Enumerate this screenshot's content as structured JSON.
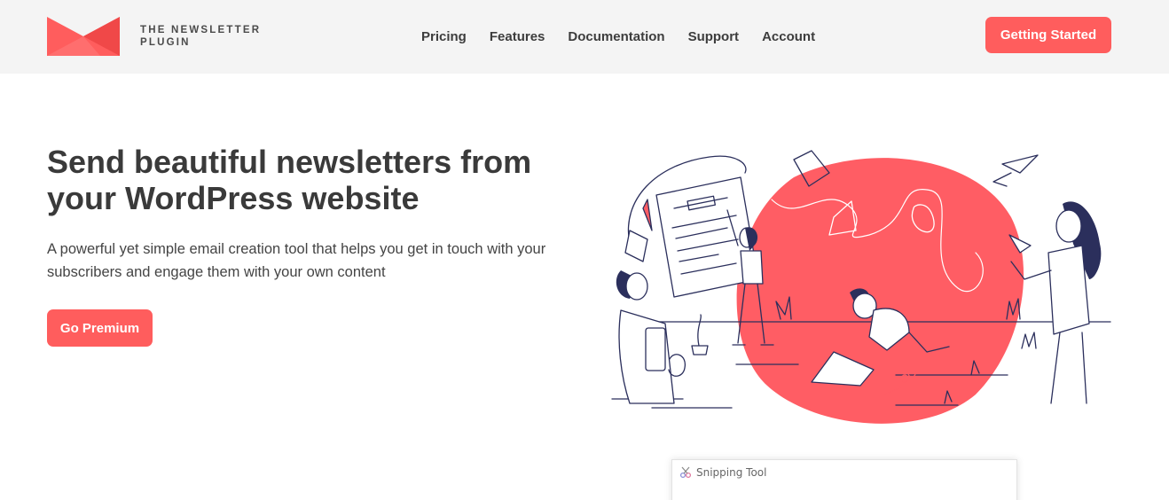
{
  "brand": {
    "line1": "THE NEWSLETTER",
    "line2": "PLUGIN",
    "accent_color": "#ff5d5d"
  },
  "nav": {
    "items": [
      {
        "label": "Pricing"
      },
      {
        "label": "Features"
      },
      {
        "label": "Documentation"
      },
      {
        "label": "Support"
      },
      {
        "label": "Account"
      }
    ],
    "cta_label": "Getting Started"
  },
  "hero": {
    "title": "Send beautiful newsletters from your WordPress website",
    "subtitle": "A powerful yet simple email creation tool that helps you get in touch with your subscribers and engage them with your own content",
    "button_label": "Go Premium",
    "illustration": "people-creating-newsletter-illustration"
  },
  "snipping_tool": {
    "title": "Snipping Tool",
    "icon": "scissors-icon"
  }
}
